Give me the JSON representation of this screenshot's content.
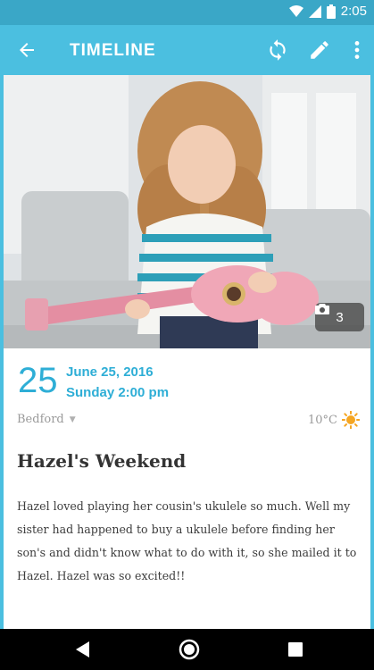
{
  "status_bar": {
    "time": "2:05",
    "icons": [
      "wifi-icon",
      "signal-icon",
      "battery-icon"
    ]
  },
  "app_bar": {
    "title": "TIMELINE",
    "actions": [
      "back-arrow-icon",
      "sync-icon",
      "edit-pencil-icon",
      "more-vert-icon"
    ]
  },
  "entry": {
    "photo_count": "3",
    "day": "25",
    "date": "June 25, 2016",
    "time": "Sunday 2:00 pm",
    "location": "Bedford",
    "temperature": "10°C",
    "weather_icon": "sun-icon",
    "title": "Hazel's Weekend",
    "body": "Hazel loved playing her cousin's ukulele so much. Well my sister had happened to buy a ukulele before finding her son's and didn't know what to do with it, so she mailed it to Hazel. Hazel was so excited!!"
  },
  "nav_bar": {
    "buttons": [
      "back-triangle-icon",
      "home-circle-icon",
      "recent-square-icon"
    ]
  },
  "colors": {
    "accent": "#4bbfe0",
    "date_blue": "#2eaed6",
    "status_bar": "#3aa7c7"
  }
}
